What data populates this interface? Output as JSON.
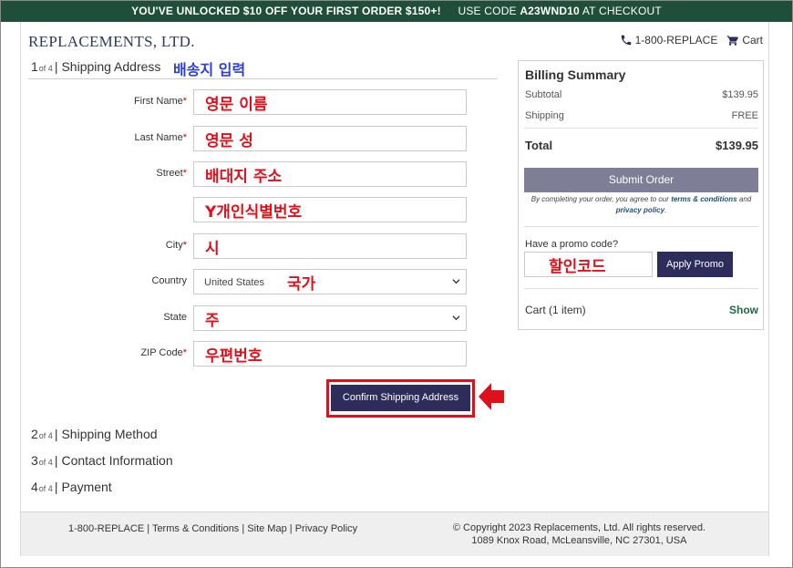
{
  "banner": {
    "offer": "YOU'VE UNLOCKED $10 OFF YOUR FIRST ORDER $150+!",
    "use_code_prefix": "USE CODE",
    "code": "A23WND10",
    "use_code_suffix": "AT CHECKOUT"
  },
  "header": {
    "logo": "REPLACEMENTS, LTD.",
    "phone": "1-800-REPLACE",
    "cart": "Cart"
  },
  "steps": [
    {
      "num": "1",
      "of": "of 4",
      "title": "Shipping Address",
      "annotation": "배송지 입력"
    },
    {
      "num": "2",
      "of": "of 4",
      "title": "Shipping Method"
    },
    {
      "num": "3",
      "of": "of 4",
      "title": "Contact Information"
    },
    {
      "num": "4",
      "of": "of 4",
      "title": "Payment"
    }
  ],
  "form": {
    "fields": [
      {
        "label": "First Name",
        "required": "*",
        "annotation": "영문 이름"
      },
      {
        "label": "Last Name",
        "required": "*",
        "annotation": "영문 성"
      },
      {
        "label": "Street",
        "required": "*",
        "annotation": "배대지 주소"
      },
      {
        "label": "",
        "required": "",
        "annotation": "Y개인식별번호"
      },
      {
        "label": "City",
        "required": "*",
        "annotation": "시"
      },
      {
        "label": "Country",
        "required": "",
        "value": "United States",
        "annotation": "국가"
      },
      {
        "label": "State",
        "required": "",
        "annotation": "주"
      },
      {
        "label": "ZIP Code",
        "required": "*",
        "annotation": "우편번호"
      }
    ],
    "confirm_button": "Confirm Shipping Address"
  },
  "billing": {
    "title": "Billing Summary",
    "subtotal_label": "Subtotal",
    "subtotal_value": "$139.95",
    "shipping_label": "Shipping",
    "shipping_value": "FREE",
    "total_label": "Total",
    "total_value": "$139.95",
    "submit_button": "Submit Order",
    "terms_prefix": "By completing your order, you agree to our",
    "terms_link": "terms & conditions",
    "terms_and": "and",
    "privacy_link": "privacy policy",
    "terms_end": ".",
    "promo_label": "Have a promo code?",
    "promo_annotation": "할인코드",
    "apply_button": "Apply Promo",
    "cart_label": "Cart (1 item)",
    "show_link": "Show"
  },
  "footer": {
    "phone": "1-800-REPLACE",
    "terms": "Terms & Conditions",
    "sitemap": "Site Map",
    "privacy": "Privacy Policy",
    "separator": "|",
    "copyright": "© Copyright 2023 Replacements, Ltd. All rights reserved.",
    "address": "1089 Knox Road, McLeansville, NC 27301, USA"
  },
  "colors": {
    "banner_bg": "#1f4f3a",
    "button_navy": "#2d2d5c",
    "submit_disabled": "#7e7e96",
    "annotation_red": "#e0101a",
    "annotation_blue": "#2b3fd6",
    "show_green": "#1f6a46"
  }
}
